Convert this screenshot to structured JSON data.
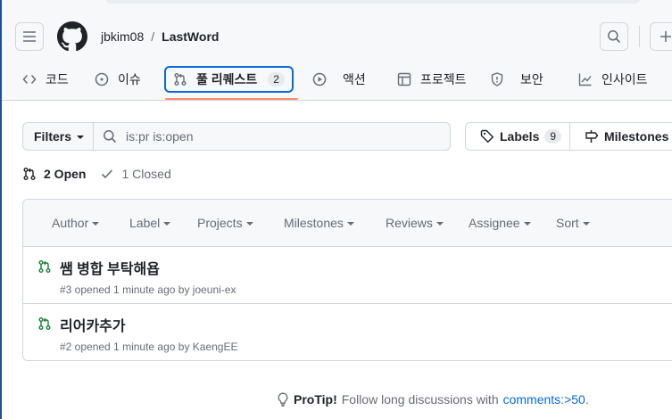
{
  "repo": {
    "owner": "jbkim08",
    "separator": "/",
    "name": "LastWord"
  },
  "tabs": [
    {
      "label": "코드"
    },
    {
      "label": "이슈"
    },
    {
      "label": "풀 리퀘스트",
      "count": "2"
    },
    {
      "label": "액션"
    },
    {
      "label": "프로젝트"
    },
    {
      "label": "보안"
    },
    {
      "label": "인사이트"
    }
  ],
  "filters": {
    "filters_label": "Filters",
    "search_value": "is:pr is:open",
    "labels_label": "Labels",
    "labels_count": "9",
    "milestones_label": "Milestones"
  },
  "states": {
    "open": "2 Open",
    "closed": "1 Closed"
  },
  "list_header": [
    "Author",
    "Label",
    "Projects",
    "Milestones",
    "Reviews",
    "Assignee",
    "Sort"
  ],
  "pull_requests": [
    {
      "title": "쌤 병합 부탁해욥",
      "meta": "#3 opened 1 minute ago by joeuni-ex"
    },
    {
      "title": "리어카추가",
      "meta": "#2 opened 1 minute ago by KaengEE"
    }
  ],
  "protip": {
    "label": "ProTip!",
    "text": "Follow long discussions with",
    "link": "comments:>50",
    "end": "."
  },
  "colors": {
    "accent": "#0969da",
    "open_pr": "#1a7f37",
    "underline": "#fd8c73"
  }
}
